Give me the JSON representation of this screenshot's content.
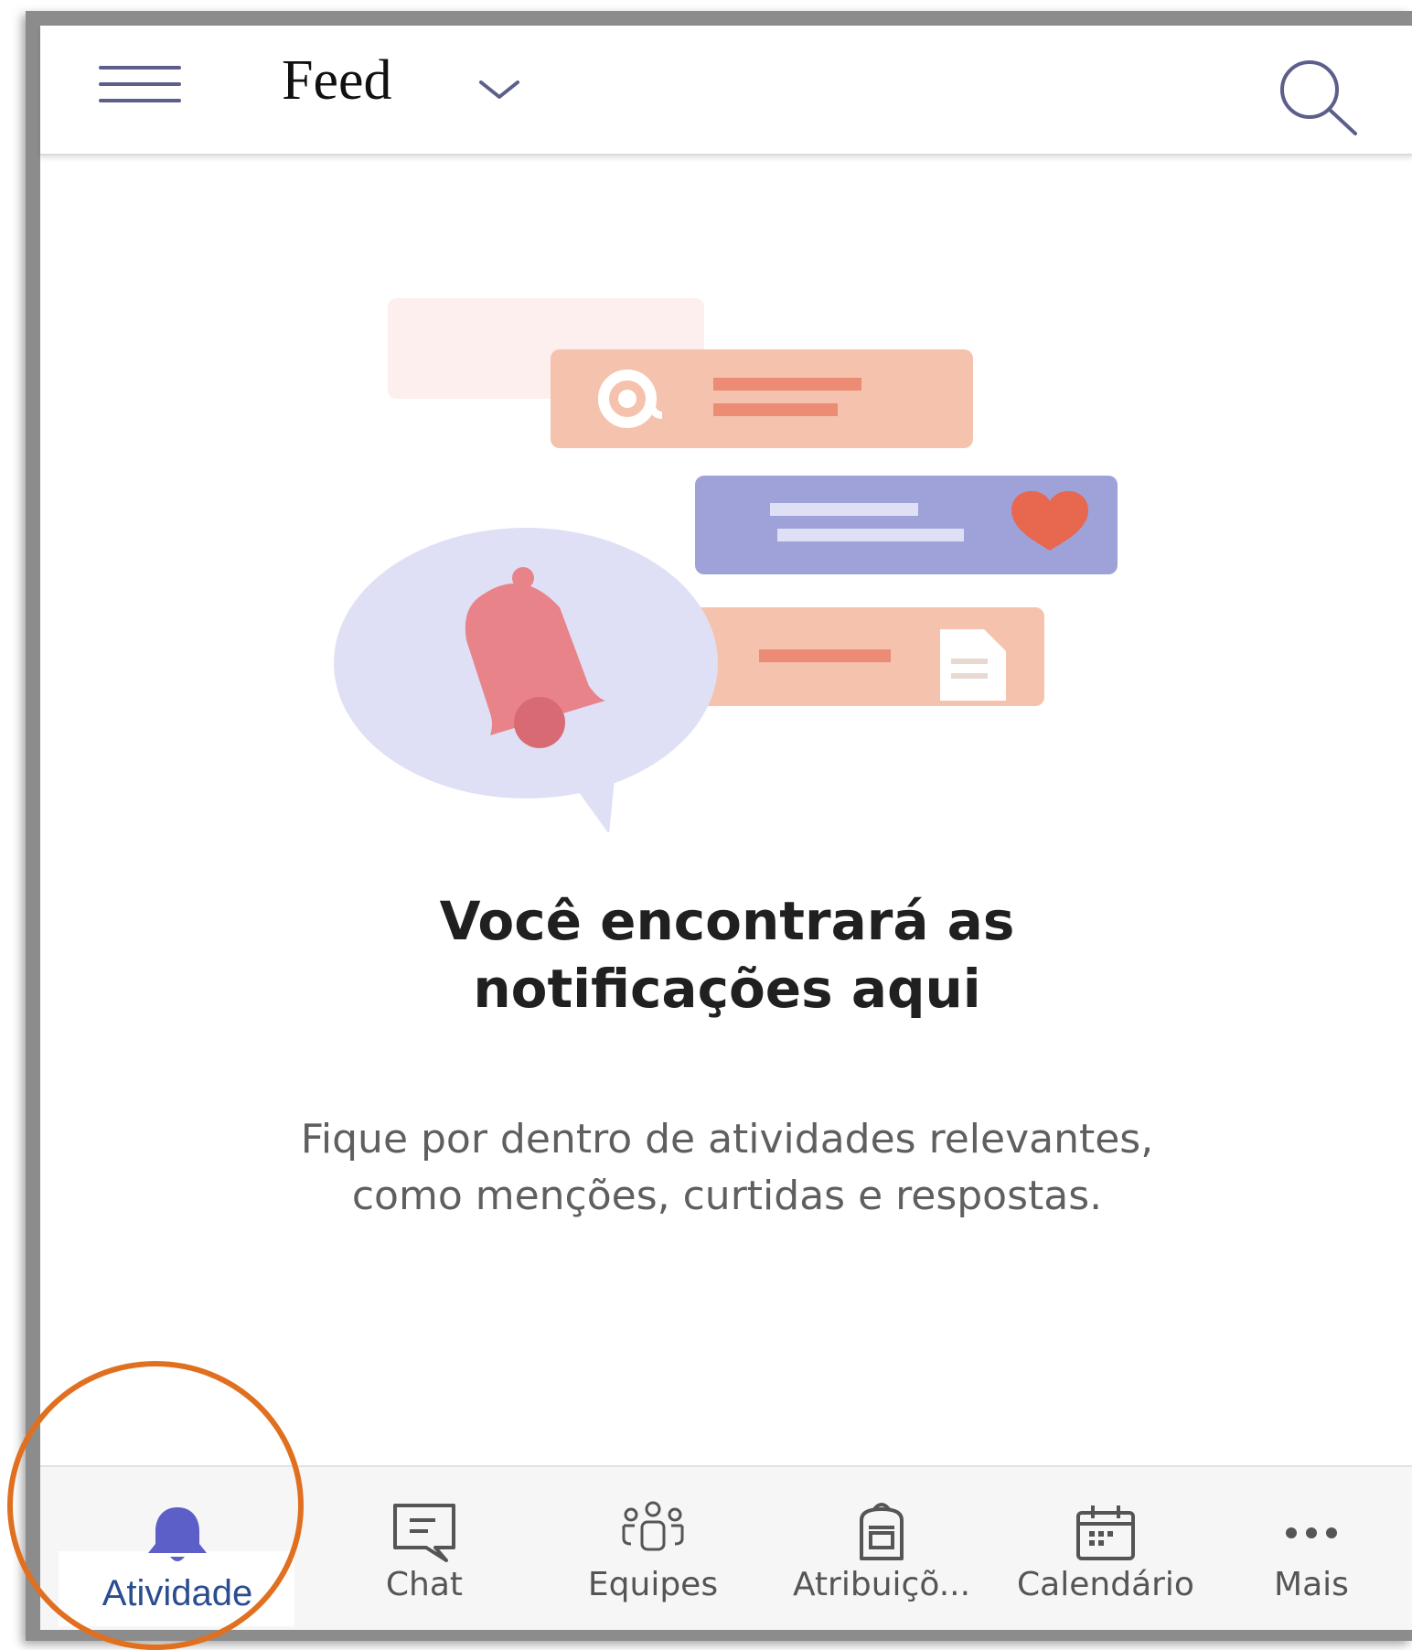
{
  "header": {
    "title": "Feed",
    "icons": {
      "menu": "hamburger-menu-icon",
      "dropdown": "chevron-down-icon",
      "search": "search-icon"
    }
  },
  "empty_state": {
    "headline": "Você encontrará as notificações aqui",
    "description": "Fique por dentro de atividades relevantes, como menções, curtidas e respostas.",
    "illustration_icons": [
      "at-mention-icon",
      "heart-icon",
      "document-icon",
      "bell-icon"
    ]
  },
  "nav": {
    "items": [
      {
        "label": "Atividade",
        "icon": "bell-icon",
        "active": true
      },
      {
        "label": "Chat",
        "icon": "chat-icon",
        "active": false
      },
      {
        "label": "Equipes",
        "icon": "teams-icon",
        "active": false
      },
      {
        "label": "Atribuiçõ...",
        "icon": "backpack-icon",
        "active": false
      },
      {
        "label": "Calendário",
        "icon": "calendar-icon",
        "active": false
      },
      {
        "label": "Mais",
        "icon": "more-icon",
        "active": false
      }
    ]
  },
  "colors": {
    "accent": "#5b5fc7",
    "highlight_ring": "#e07020",
    "active_label": "#2a4d8f",
    "peach": "#f5c2ad",
    "lavender": "#9ea2d9",
    "bell": "#e8838a"
  }
}
